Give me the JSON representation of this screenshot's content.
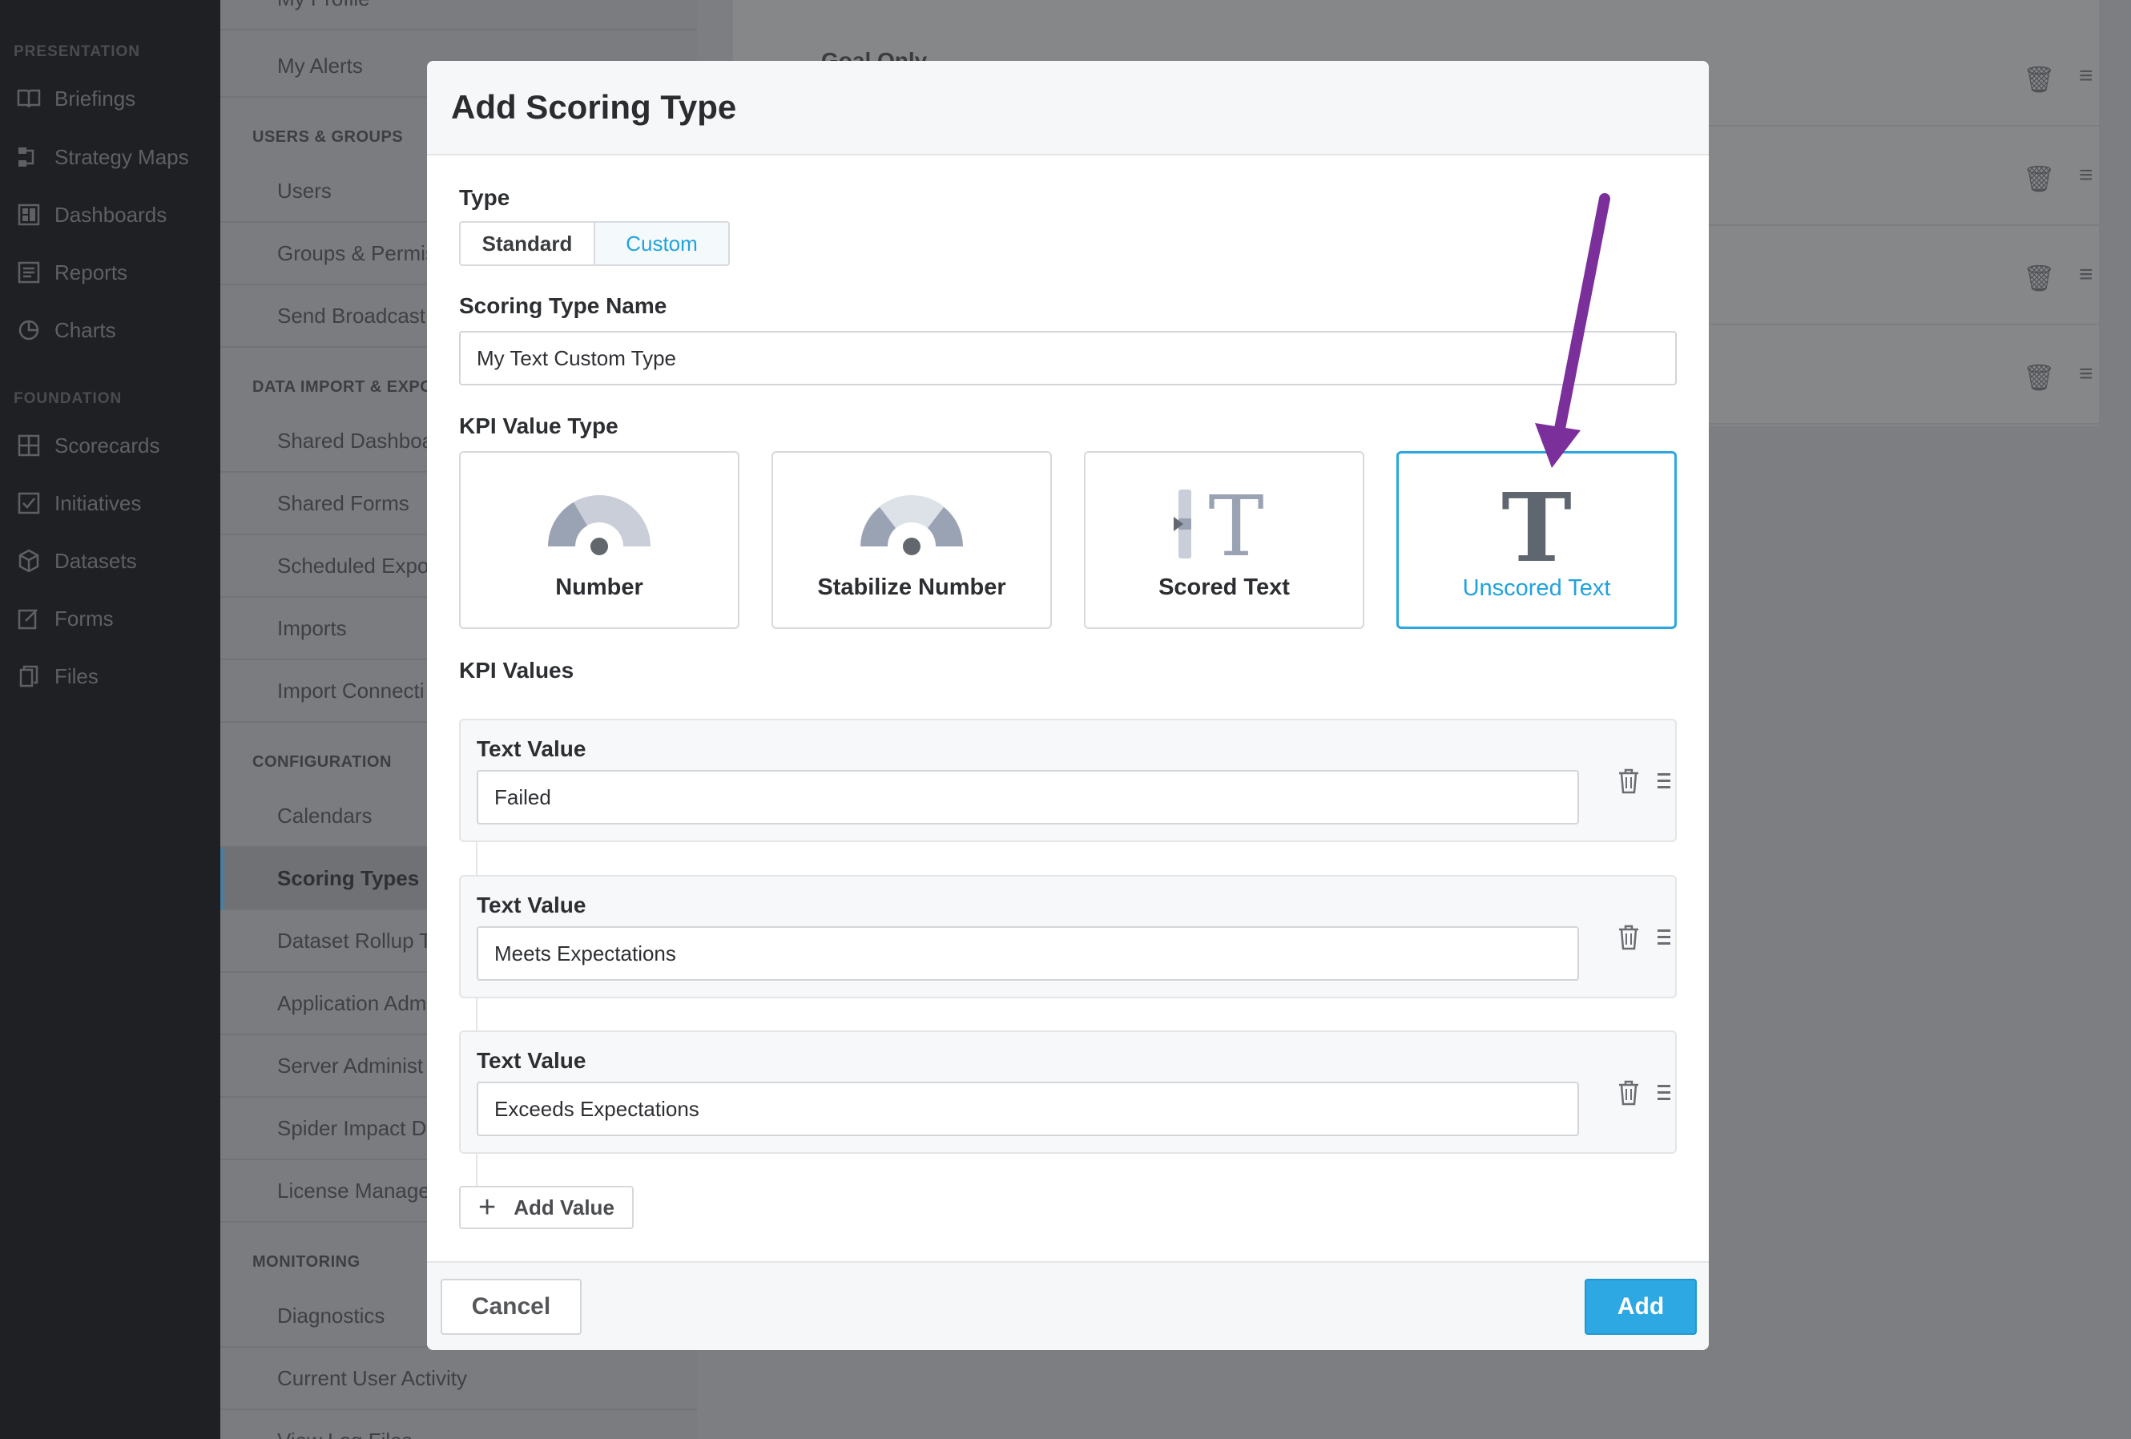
{
  "nav": {
    "presentation_label": "PRESENTATION",
    "foundation_label": "FOUNDATION",
    "presentation_items": [
      {
        "label": "Briefings",
        "icon": "book-icon"
      },
      {
        "label": "Strategy Maps",
        "icon": "strategy-map-icon"
      },
      {
        "label": "Dashboards",
        "icon": "dashboard-icon"
      },
      {
        "label": "Reports",
        "icon": "report-icon"
      },
      {
        "label": "Charts",
        "icon": "pie-chart-icon"
      }
    ],
    "foundation_items": [
      {
        "label": "Scorecards",
        "icon": "scorecard-icon"
      },
      {
        "label": "Initiatives",
        "icon": "checkbox-icon"
      },
      {
        "label": "Datasets",
        "icon": "cube-icon"
      },
      {
        "label": "Forms",
        "icon": "form-icon"
      },
      {
        "label": "Files",
        "icon": "files-icon"
      }
    ]
  },
  "admin_menu": {
    "top_items": [
      "My Profile",
      "My Alerts"
    ],
    "users_groups_label": "USERS & GROUPS",
    "users_groups_items": [
      "Users",
      "Groups & Permis",
      "Send Broadcast"
    ],
    "data_import_label": "DATA IMPORT & EXPO",
    "data_import_items": [
      "Shared Dashboa",
      "Shared Forms",
      "Scheduled Expo",
      "Imports",
      "Import Connecti"
    ],
    "configuration_label": "CONFIGURATION",
    "configuration_items": [
      "Calendars",
      "Scoring Types",
      "Dataset Rollup T",
      "Application Adm",
      "Server Administ",
      "Spider Impact D",
      "License Manage"
    ],
    "monitoring_label": "MONITORING",
    "monitoring_items": [
      "Diagnostics",
      "Current User Activity",
      "View Log Files"
    ]
  },
  "background_list": {
    "partial_item": "Goal Only"
  },
  "modal": {
    "title": "Add Scoring Type",
    "type_label": "Type",
    "type_options": [
      "Standard",
      "Custom"
    ],
    "type_selected": "Custom",
    "name_label": "Scoring Type Name",
    "name_value": "My Text Custom Type",
    "kpi_value_type_label": "KPI Value Type",
    "kpi_value_types": [
      {
        "label": "Number",
        "icon": "gauge-icon"
      },
      {
        "label": "Stabilize Number",
        "icon": "gauge-icon"
      },
      {
        "label": "Scored Text",
        "icon": "scored-text-icon"
      },
      {
        "label": "Unscored Text",
        "icon": "text-icon"
      }
    ],
    "kpi_value_type_selected": "Unscored Text",
    "kpi_values_label": "KPI Values",
    "kpi_values": [
      {
        "label": "Text Value",
        "value": "Failed"
      },
      {
        "label": "Text Value",
        "value": "Meets Expectations"
      },
      {
        "label": "Text Value",
        "value": "Exceeds Expectations"
      }
    ],
    "add_value_label": "Add Value",
    "cancel_label": "Cancel",
    "add_label": "Add"
  },
  "colors": {
    "accent": "#2ea8e2",
    "annotation_arrow": "#7b2f9b"
  }
}
